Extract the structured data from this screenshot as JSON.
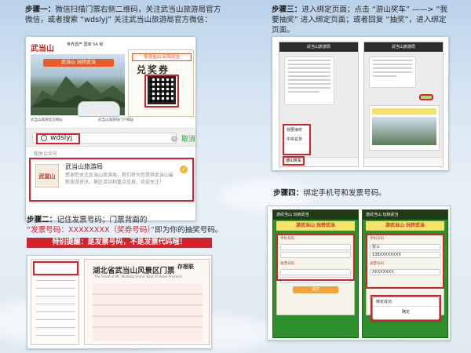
{
  "step1": {
    "label": "步骤一：",
    "text": "微信扫描门票右侧二维码，关注武当山旅游局官方微信，或者搜索 “wdslyj” 关注武当山旅游局官方微信："
  },
  "ticket": {
    "logo": "武当山",
    "header_text": "世界遗产  国家 5A 级",
    "banner": "武当山 玩转武当",
    "right_banner": "惊喜金山 玩转武当",
    "title": "兑奖券",
    "footer_left": "武当山旅游官方网站",
    "footer_right": "武当山旅游局门户网站"
  },
  "search": {
    "value": "wdslyj",
    "cancel": "取消",
    "hint": "相关公众号"
  },
  "result": {
    "avatar": "武當山",
    "name": "武当山旅游局",
    "description": "感谢您关注武当山旅游局，我们将为您提供武当山最新旅游资讯、景区活动和重点信息，欢迎关注！"
  },
  "step2": {
    "label": "步骤二：",
    "line1": "记住发票号码；门票背面的",
    "line2_red": "“发票号码：XXXXXXXX（奖券号码）”",
    "line2_rest": "即为你的抽奖号码。",
    "warning": "特别提醒：是发票号码，不是发票代码哦！"
  },
  "invoice": {
    "title": "湖北省武当山风景区门票",
    "subtitle": "The Ticket of Mt. Wudang Scenic Spot of Hubei Province",
    "stub": "存根联"
  },
  "step3": {
    "label": "步骤三：",
    "text": "进入绑定页面；点击 “游山奖车” ——> “我要抽奖” 进入绑定页面；或者回复 “抽奖”，进入绑定页面。",
    "phone_title": "武当山旅游局",
    "menu_items": [
      "我要抽奖",
      "中奖名单",
      "游山奖车"
    ]
  },
  "step4": {
    "label": "步骤四：",
    "text": "绑定手机号和发票号码。",
    "phone_title": "游武当山 玩转武当",
    "banner": "游武当山 玩转武当",
    "labels": [
      "手机号码",
      "发票号码"
    ],
    "sample_name": "张三",
    "sample_phone": "138XXXXXXXX",
    "sample_invoice": "XXXXXXXX",
    "submit": "提交",
    "dialog_title": "绑定成功",
    "dialog_button": "确定"
  },
  "colors": {
    "accent_red": "#d6232b",
    "wechat_green": "#2aa23a"
  }
}
